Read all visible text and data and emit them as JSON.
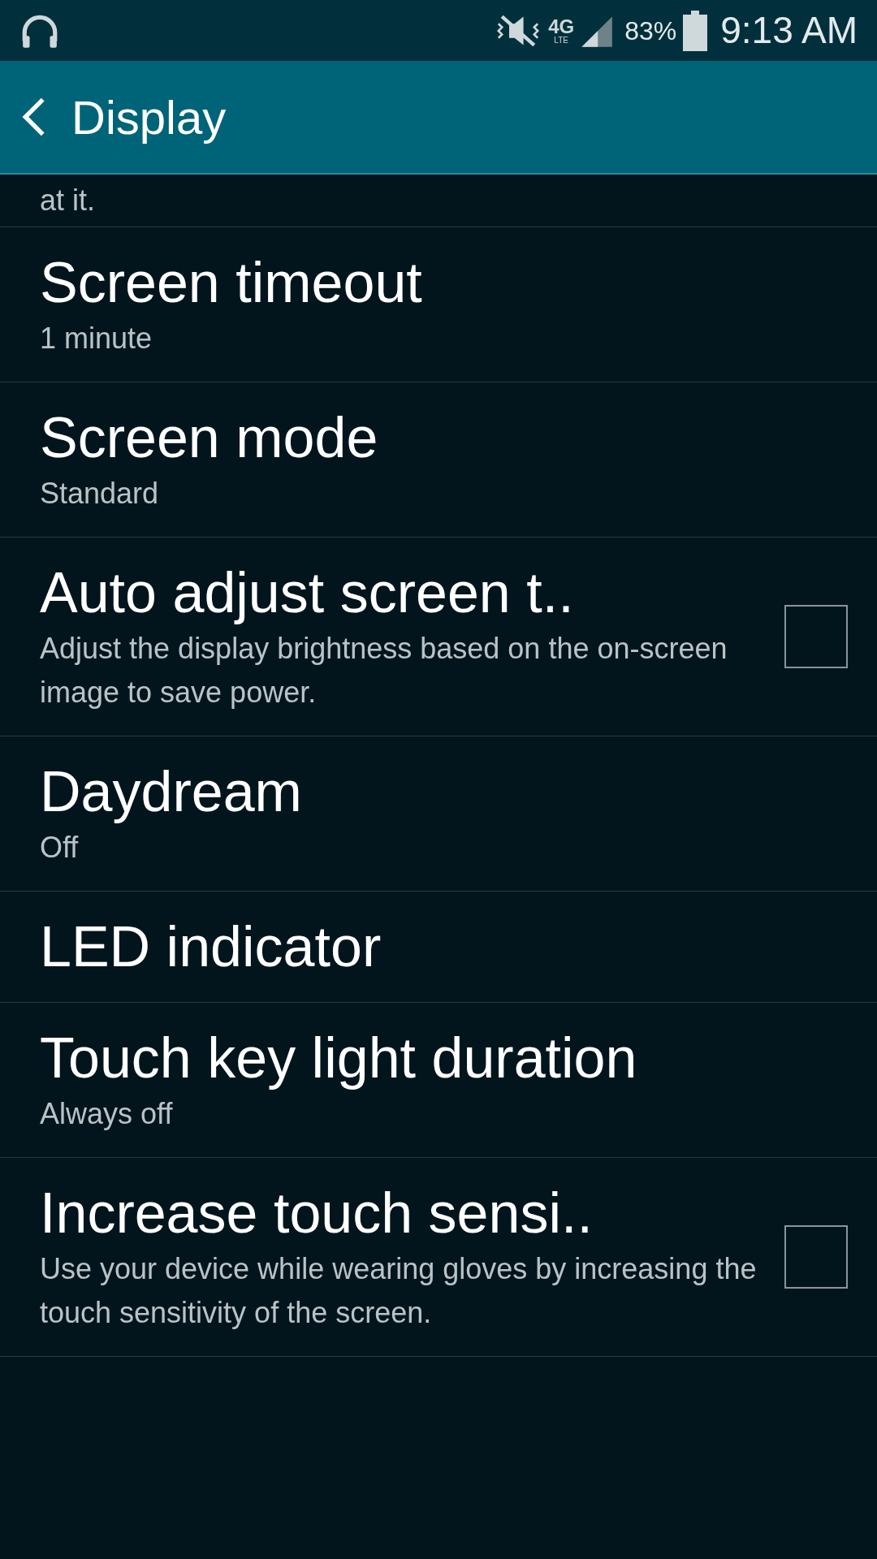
{
  "status_bar": {
    "network": "4G",
    "network_sub": "LTE",
    "battery": "83%",
    "time": "9:13 AM"
  },
  "header": {
    "title": "Display"
  },
  "partial_text": "at it.",
  "items": [
    {
      "kind": "text",
      "title": "Screen timeout",
      "summary": "1 minute"
    },
    {
      "kind": "text",
      "title": "Screen mode",
      "summary": "Standard"
    },
    {
      "kind": "checkbox",
      "title": "Auto adjust screen t..",
      "summary": "Adjust the display brightness based on the on-screen image to save power.",
      "checked": false
    },
    {
      "kind": "text",
      "title": "Daydream",
      "summary": "Off"
    },
    {
      "kind": "text",
      "title": "LED indicator"
    },
    {
      "kind": "text",
      "title": "Touch key light duration",
      "summary": "Always off"
    },
    {
      "kind": "checkbox",
      "title": "Increase touch sensi..",
      "summary": "Use your device while wearing gloves by increasing the touch sensitivity of the screen.",
      "checked": false
    }
  ]
}
